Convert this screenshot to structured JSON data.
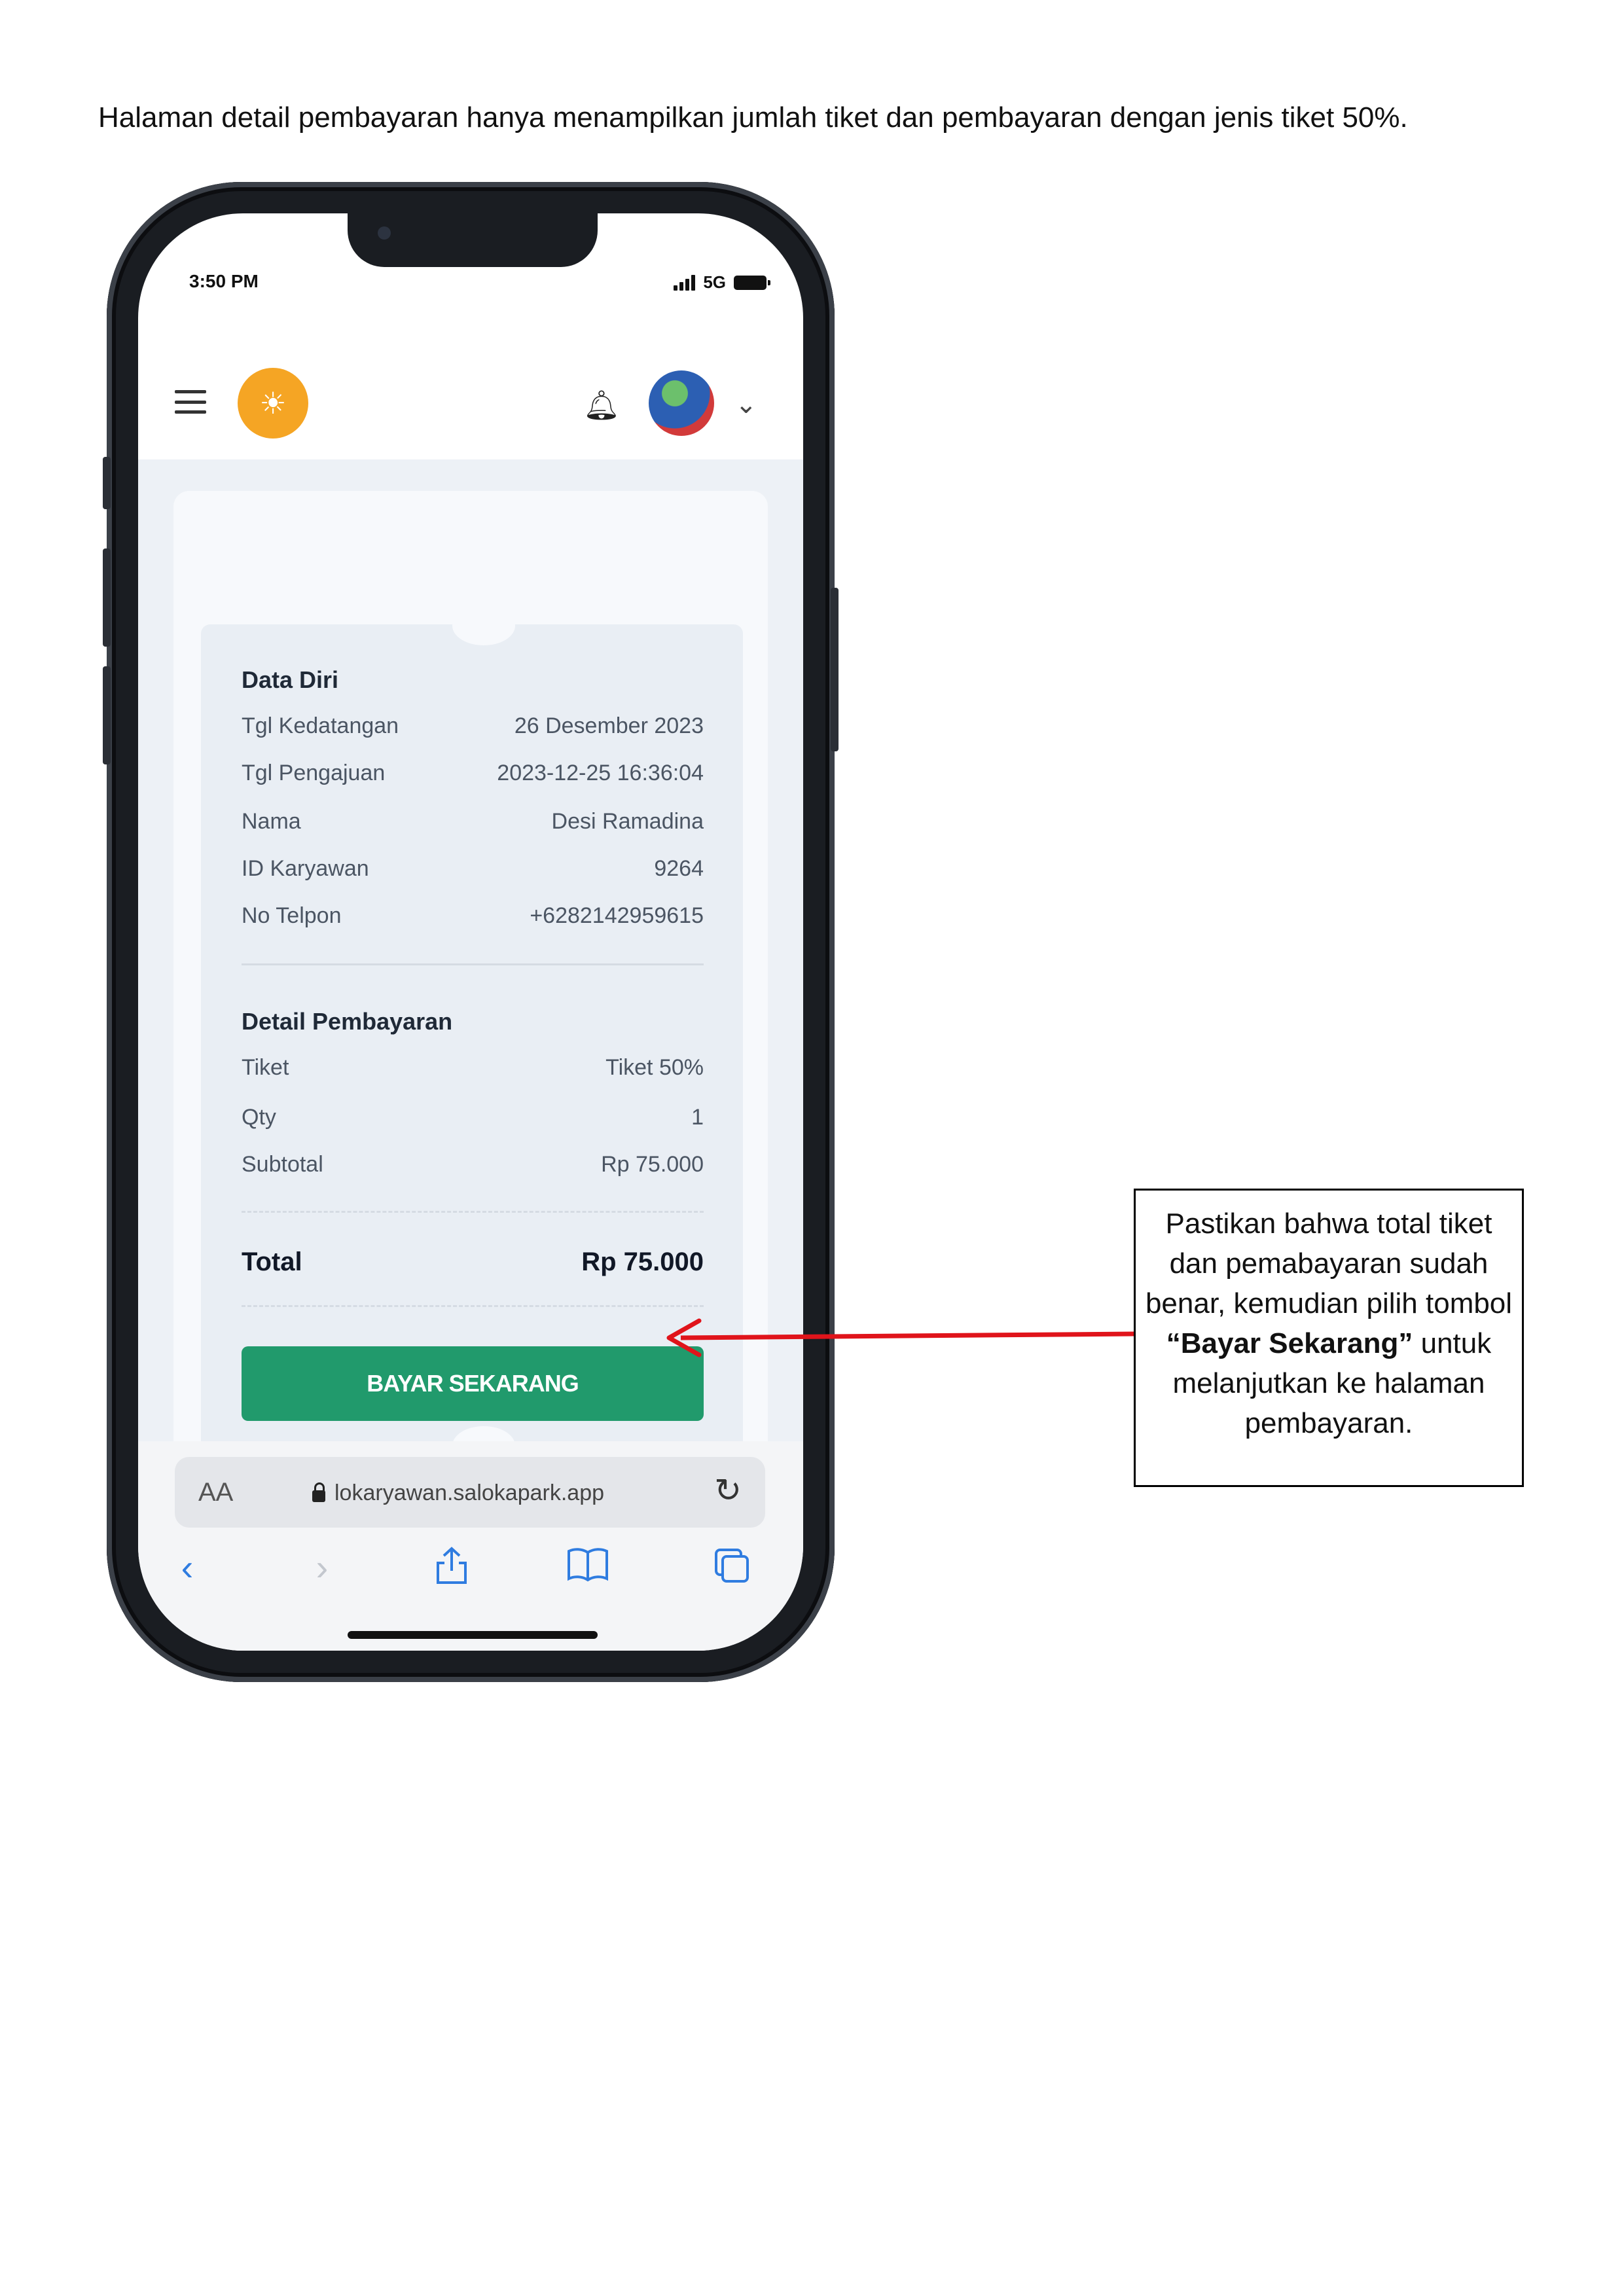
{
  "intro_text": "Halaman detail pembayaran hanya menampilkan jumlah tiket dan pembayaran dengan jenis tiket 50%.",
  "status_bar": {
    "time": "3:50 PM",
    "network": "5G"
  },
  "icons": [
    "menu-icon",
    "sun-logo-icon",
    "bell-icon",
    "avatar",
    "chevron-down-icon",
    "lock-icon",
    "reload-icon",
    "back-icon",
    "forward-icon",
    "share-icon",
    "bookmarks-icon",
    "tabs-icon"
  ],
  "data_diri": {
    "title": "Data Diri",
    "rows": [
      {
        "label": "Tgl Kedatangan",
        "value": "26 Desember 2023"
      },
      {
        "label": "Tgl Pengajuan",
        "value": "2023-12-25 16:36:04"
      },
      {
        "label": "Nama",
        "value": "Desi Ramadina"
      },
      {
        "label": "ID Karyawan",
        "value": "9264"
      },
      {
        "label": "No Telpon",
        "value": "+6282142959615"
      }
    ]
  },
  "detail_pembayaran": {
    "title": "Detail Pembayaran",
    "rows": [
      {
        "label": "Tiket",
        "value": "Tiket 50%"
      },
      {
        "label": "Qty",
        "value": "1"
      },
      {
        "label": "Subtotal",
        "value": "Rp 75.000"
      }
    ],
    "total_label": "Total",
    "total_value": "Rp 75.000"
  },
  "pay_button_label": "BAYAR SEKARANG",
  "browser": {
    "aa_label": "AA",
    "url": "lokaryawan.salokapark.app"
  },
  "callout": {
    "line1": "Pastikan bahwa total tiket dan pemabayaran sudah benar, kemudian pilih tombol ",
    "bold": "“Bayar Sekarang”",
    "line2": " untuk melanjutkan ke halaman pembayaran."
  },
  "colors": {
    "button": "#219a6c",
    "logo": "#f5a524",
    "arrow": "#e0141b",
    "ios_blue": "#2f7ce0"
  }
}
